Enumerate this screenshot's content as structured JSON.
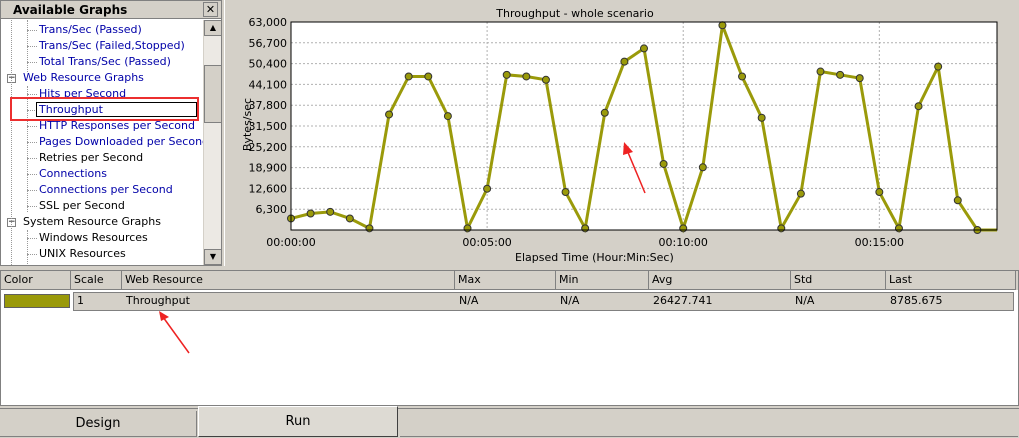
{
  "tree": {
    "title": "Available Graphs",
    "close": "✕",
    "items": [
      {
        "label": "Trans/Sec (Passed)",
        "link": true
      },
      {
        "label": "Trans/Sec (Failed,Stopped)",
        "link": true
      },
      {
        "label": "Total Trans/Sec (Passed)",
        "link": true
      },
      {
        "label": "Web Resource Graphs",
        "link": true,
        "group": true
      },
      {
        "label": "Hits per Second",
        "link": true
      },
      {
        "label": "Throughput",
        "link": true,
        "selected": true
      },
      {
        "label": "HTTP Responses per Second",
        "link": true
      },
      {
        "label": "Pages Downloaded per Second",
        "link": true
      },
      {
        "label": "Retries per Second",
        "link": false
      },
      {
        "label": "Connections",
        "link": true
      },
      {
        "label": "Connections per Second",
        "link": true
      },
      {
        "label": "SSL per Second",
        "link": false
      },
      {
        "label": "System Resource Graphs",
        "link": false,
        "group": true
      },
      {
        "label": "Windows Resources",
        "link": false
      },
      {
        "label": "UNIX Resources",
        "link": false
      }
    ]
  },
  "chart_data": {
    "type": "line",
    "title": "Throughput - whole scenario",
    "xlabel": "Elapsed Time (Hour:Min:Sec)",
    "ylabel": "Bytes/sec",
    "ylim": [
      0,
      63000
    ],
    "yticks": [
      "63,000",
      "56,700",
      "50,400",
      "44,100",
      "37,800",
      "31,500",
      "25,200",
      "18,900",
      "12,600",
      "6,300"
    ],
    "ytick_values": [
      63000,
      56700,
      50400,
      44100,
      37800,
      31500,
      25200,
      18900,
      12600,
      6300
    ],
    "xlim": [
      0,
      1080
    ],
    "xticks": [
      "00:00:00",
      "00:05:00",
      "00:10:00",
      "00:15:00"
    ],
    "xtick_values": [
      0,
      300,
      600,
      900
    ],
    "grid": true,
    "color": "#9a9a0a",
    "series": [
      {
        "x": [
          0,
          30,
          60,
          90,
          120,
          150,
          180,
          210,
          240,
          270,
          300,
          330,
          360,
          390,
          420,
          450,
          480,
          510,
          540,
          570,
          600,
          630,
          660,
          690,
          720,
          750,
          780,
          810,
          840,
          870,
          900,
          930,
          960,
          990,
          1020,
          1050,
          1080
        ],
        "values": [
          3500,
          5000,
          5500,
          3500,
          500,
          35000,
          46500,
          46500,
          34500,
          500,
          12500,
          47000,
          46500,
          45500,
          11500,
          500,
          35500,
          51000,
          55000,
          20000,
          500,
          19000,
          62000,
          46500,
          34000,
          500,
          11000,
          48000,
          47000,
          46000,
          11500,
          500,
          37500,
          49500,
          9000,
          0,
          0
        ]
      }
    ]
  },
  "table": {
    "headers": [
      "Color",
      "Scale",
      "Web Resource",
      "Max",
      "Min",
      "Avg",
      "Std",
      "Last"
    ],
    "row": {
      "color": "#9a9a0a",
      "scale": "1",
      "resource": "Throughput",
      "max": "N/A",
      "min": "N/A",
      "avg": "26427.741",
      "std": "N/A",
      "last": "8785.675"
    }
  },
  "tabs": [
    "Design",
    "Run"
  ]
}
